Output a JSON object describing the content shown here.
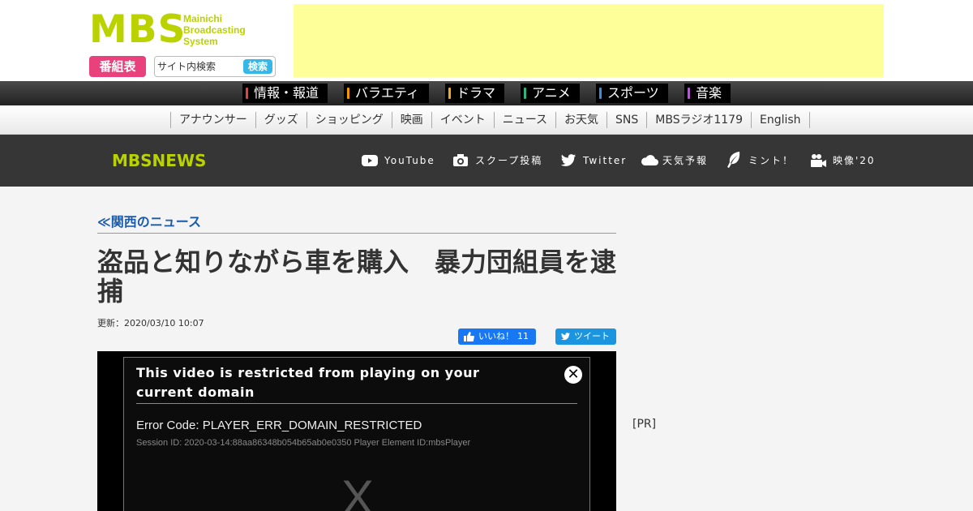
{
  "header": {
    "logo_text": "MBS",
    "logo_sub": [
      "Mainichi",
      "Broadcasting",
      "System"
    ],
    "program_button": "番組表",
    "search_placeholder": "サイト内検索",
    "search_button": "検索"
  },
  "genre_nav": [
    {
      "label": "情報・報道",
      "color": "#e8413c"
    },
    {
      "label": "バラエティ",
      "color": "#f39800"
    },
    {
      "label": "ドラマ",
      "color": "#f5a623"
    },
    {
      "label": "アニメ",
      "color": "#2fb47c"
    },
    {
      "label": "スポーツ",
      "color": "#3a8fd8"
    },
    {
      "label": "音楽",
      "color": "#b05cc8"
    }
  ],
  "sub_nav": [
    "アナウンサー",
    "グッズ",
    "ショッピング",
    "映画",
    "イベント",
    "ニュース",
    "お天気",
    "SNS",
    "MBSラジオ1179",
    "English"
  ],
  "news_bar": {
    "logo": "MBSNEWS",
    "links": [
      {
        "label": "YouTube",
        "icon": "youtube-icon"
      },
      {
        "label": "スクープ投稿",
        "icon": "camera-icon"
      },
      {
        "label": "Twitter",
        "icon": "twitter-icon"
      },
      {
        "label": "天気予報",
        "icon": "cloud-icon"
      },
      {
        "label": "ミント！",
        "icon": "leaf-icon"
      },
      {
        "label": "映像'20",
        "icon": "video-camera-icon"
      }
    ]
  },
  "article": {
    "breadcrumb": "≪関西のニュース",
    "title": "盗品と知りながら車を購入　暴力団組員を逮捕",
    "updated": "更新：2020/03/10 10:07",
    "like_label": "いいね！",
    "like_count": "11",
    "tweet_label": "ツイート"
  },
  "player": {
    "error_title": "This video is restricted from playing on your current domain",
    "error_code": "Error Code: PLAYER_ERR_DOMAIN_RESTRICTED",
    "session": "Session ID: 2020-03-14:88aa86348b054b65ab0e0350 Player Element ID:mbsPlayer",
    "close_glyph": "✕",
    "placeholder_glyph": "X"
  },
  "sidebar": {
    "pr_label": "[PR]"
  },
  "colors": {
    "brand_green": "#b9d200",
    "program_pink": "#e8417c",
    "search_blue": "#35b7e8",
    "facebook_blue": "#1877f2",
    "twitter_blue": "#1b95e0"
  }
}
